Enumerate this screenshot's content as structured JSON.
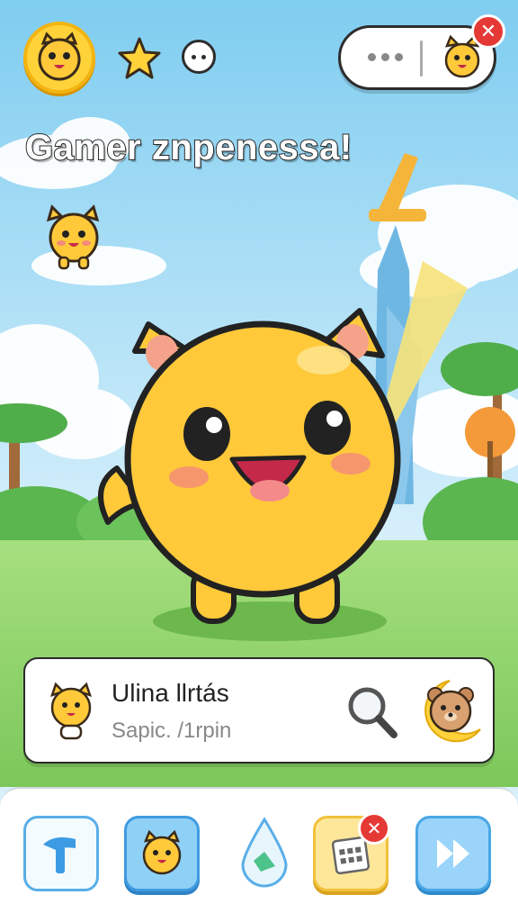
{
  "header": {
    "avatar_icon": "yellow-pet-face-icon",
    "star_icon": "star-icon",
    "dots_icon": "more-dots-icon",
    "pill_icon": "pet-mini-icon",
    "close_icon_glyph": "✕"
  },
  "title": "Gamer znpenessa!",
  "info_card": {
    "name": "Ulina llrtás",
    "subtitle": "Sapic. /1rpin",
    "search_icon": "magnifier-icon",
    "moon_icon": "bear-moon-icon"
  },
  "bottom_bar": {
    "items": [
      {
        "icon": "hammer-icon"
      },
      {
        "icon": "pet-icon"
      },
      {
        "icon": "drop-icon"
      },
      {
        "icon": "calendar-icon",
        "badge": "✕"
      },
      {
        "icon": "fast-forward-icon"
      }
    ]
  },
  "colors": {
    "sky": "#bfe6f7",
    "grass": "#8fd36a",
    "pet": "#ffc93a",
    "accent_blue": "#4aa7e6",
    "badge_red": "#e53935"
  }
}
